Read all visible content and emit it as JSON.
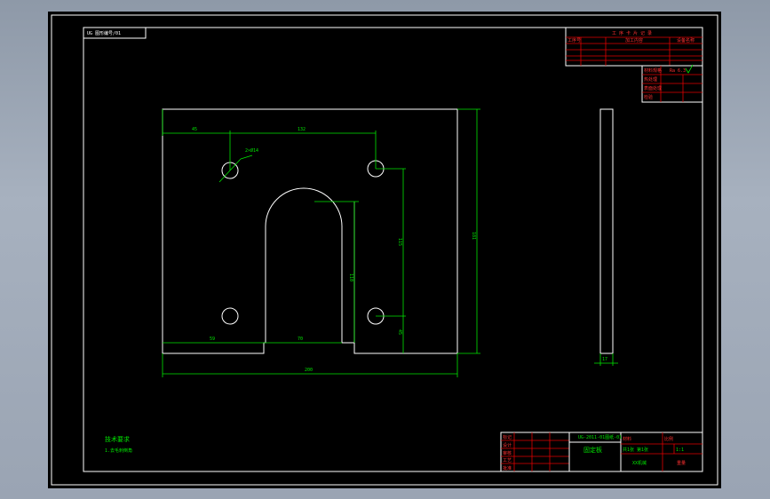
{
  "top_left_label": "UG 图形编号/01",
  "process_card": {
    "title": "工 序 卡 片 记 录",
    "row_labels": [
      "工序号",
      "加工内容",
      "设备名称"
    ]
  },
  "stamp": {
    "row_labels": [
      "材料规格",
      "热处理",
      "表面处理",
      "检验"
    ],
    "roughness": "Ra 6.3"
  },
  "dimensions": {
    "top_left_offset": "45",
    "hole_spacing_x": "132",
    "hole_callout": "2×Ø14",
    "overall_height": "181",
    "right_vertical": "115",
    "slot_depth": "110",
    "bottom_small": "45",
    "bottom_left": "59",
    "slot_width": "70",
    "overall_width": "200",
    "thickness": "17"
  },
  "notes": {
    "heading": "技术要求",
    "item1": "1.去毛刺倒角"
  },
  "title_block": {
    "left_labels": [
      "标记",
      "设计",
      "审核",
      "工艺",
      "批准"
    ],
    "drawing_no": "UG-2011-01图纸-01",
    "part_name": "固定板",
    "material_label": "材料",
    "scale_label": "比例",
    "sheet_label": "共1张 第1张",
    "company": "XX机械",
    "weight_label": "重量",
    "scale_value": "1:1"
  }
}
